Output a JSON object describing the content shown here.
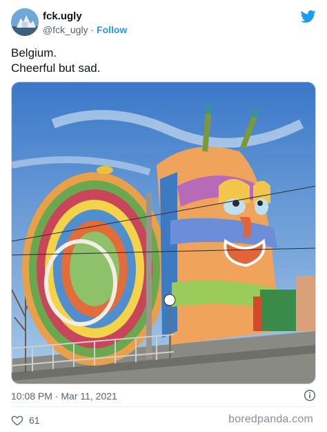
{
  "header": {
    "display_name": "fck.ugly",
    "handle": "@fck_ugly",
    "separator": "·",
    "follow_label": "Follow"
  },
  "tweet": {
    "line1": "Belgium.",
    "line2": "Cheerful but sad."
  },
  "media": {
    "alt_subject": "",
    "icon": "photo"
  },
  "meta": {
    "timestamp": "10:08 PM · Mar 11, 2021",
    "info_icon": "info-circle"
  },
  "actions": {
    "like_icon": "heart-outline",
    "like_count": "61"
  },
  "watermark": "boredpanda.com",
  "colors": {
    "accent": "#1d9bf0",
    "text": "#0f1419",
    "secondary": "#536471"
  }
}
